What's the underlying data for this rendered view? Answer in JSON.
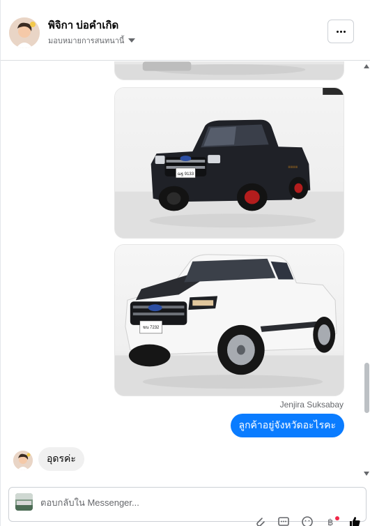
{
  "header": {
    "title": "พิจิกา บ่อคำเกิด",
    "subtitle": "มอบหมายการสนทนานี้",
    "more_icon": "more-horizontal-icon"
  },
  "thread": {
    "images": [
      {
        "name": "photo-partial-top",
        "description_icon": "photo-icon"
      },
      {
        "name": "photo-ford-ranger-black",
        "plate": "ฌฐ 9133"
      },
      {
        "name": "photo-ford-ranger-white",
        "plate": "ฆน 7232"
      }
    ],
    "sender_name": "Jenjira Suksabay",
    "outgoing_message": "ลูกค้าอยู่จังหวัดอะไรคะ",
    "incoming_message": "อุดรค่ะ"
  },
  "composer": {
    "placeholder": "ตอบกลับใน Messenger...",
    "tool_icons": [
      "attach-icon",
      "message-template-icon",
      "emoji-icon",
      "baht-payment-icon",
      "thumbs-up-icon"
    ]
  },
  "colors": {
    "outgoing_bubble": "#0a7cff",
    "incoming_bubble": "#f0f0f0",
    "notification_dot": "#f02849"
  }
}
